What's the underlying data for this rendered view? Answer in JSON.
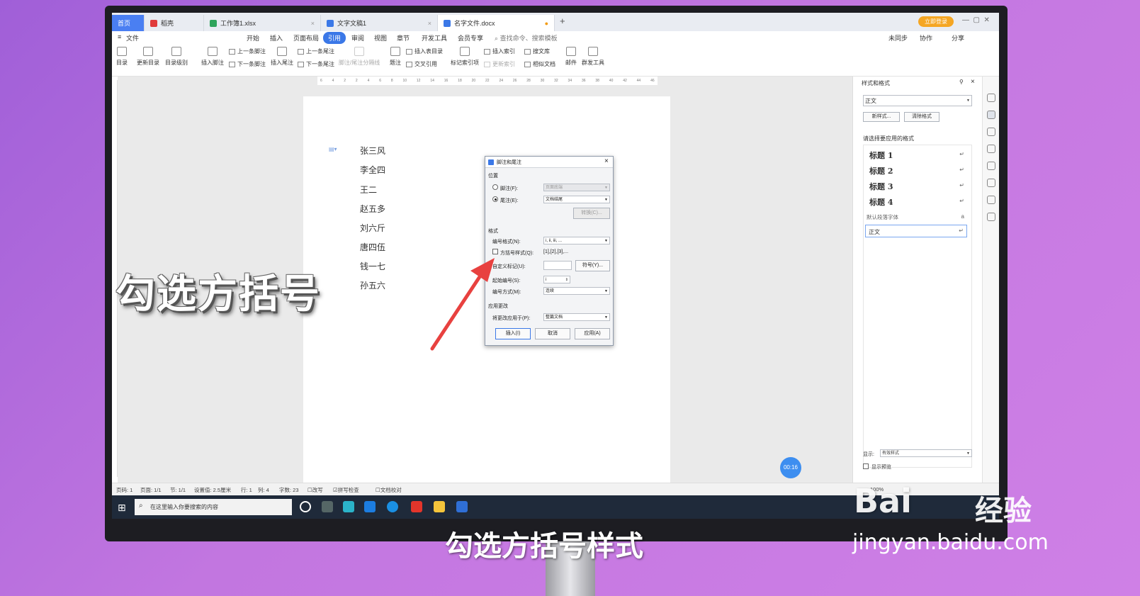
{
  "tabs": [
    {
      "label": "首页",
      "color": "#4a7ff2"
    },
    {
      "label": "稻壳",
      "color": "#e03b3b"
    },
    {
      "label": "工作簿1.xlsx",
      "color": "#2fa45c"
    },
    {
      "label": "文字文稿1",
      "color": "#3b78e7"
    },
    {
      "label": "名字文件.docx",
      "color": "#3b78e7"
    }
  ],
  "tab_add": "+",
  "login_button": "立即登录",
  "menu": [
    "文件",
    "开始",
    "插入",
    "页面布局",
    "引用",
    "审阅",
    "视图",
    "章节",
    "开发工具",
    "会员专享"
  ],
  "menu_active": "引用",
  "search_placeholder": "查找命令、搜索模板",
  "top_right": [
    "未同步",
    "协作",
    "分享"
  ],
  "ribbon": {
    "toc": "目录",
    "update_toc": "更新目录",
    "toc_level": "目录级别",
    "insert_footnote": "插入脚注",
    "prev_footnote": "上一条脚注",
    "next_footnote": "下一条脚注",
    "insert_endnote": "插入尾注",
    "prev_endnote": "上一条尾注",
    "next_endnote": "下一条尾注",
    "separator": "脚注/尾注分隔线",
    "caption": "题注",
    "insert_table_toc": "插入表目录",
    "cross_ref": "交叉引用",
    "mark_index": "标记索引项",
    "insert_index": "插入索引",
    "update_index": "更新索引",
    "search_lib": "搜文库",
    "similar": "相似文档",
    "mail": "邮件",
    "mass_tool": "群发工具"
  },
  "ruler_ticks": [
    "6",
    "4",
    "2",
    "2",
    "4",
    "6",
    "8",
    "10",
    "12",
    "14",
    "16",
    "18",
    "20",
    "22",
    "24",
    "26",
    "28",
    "30",
    "32",
    "34",
    "36",
    "38",
    "40",
    "42",
    "44",
    "46"
  ],
  "names": [
    "张三风",
    "李全四",
    "王二",
    "赵五多",
    "刘六斤",
    "唐四伍",
    "钱一七",
    "孙五六"
  ],
  "dialog": {
    "title": "脚注和尾注",
    "position_label": "位置",
    "footnote_label": "脚注(F):",
    "footnote_value": "页面底端",
    "endnote_label": "尾注(E):",
    "endnote_value": "文档结尾",
    "convert_button": "转换(C)...",
    "format_label": "格式",
    "number_format_label": "编号格式(N):",
    "number_format_value": "i, ii, iii, ...",
    "bracket_label": "方括号样式(Q):",
    "bracket_value": "[1],[2],[3],...",
    "custom_mark_label": "自定义标记(U):",
    "symbol_button": "符号(Y)...",
    "start_label": "起始编号(S):",
    "start_value": "i",
    "numbering_label": "编号方式(M):",
    "numbering_value": "连续",
    "apply_section": "应用更改",
    "apply_to_label": "将更改应用于(P):",
    "apply_to_value": "整篇文档",
    "insert_button": "插入(I)",
    "cancel_button": "取消",
    "apply_button": "应用(A)"
  },
  "pane": {
    "title": "样式和格式",
    "current_style": "正文",
    "new_style": "新样式...",
    "clear_format": "清除格式",
    "choose_label": "请选择要应用的格式",
    "styles": [
      "标题 1",
      "标题 2",
      "标题 3",
      "标题 4"
    ],
    "default_font": "默认段落字体",
    "body": "正文",
    "show_label": "显示:",
    "show_value": "有效样式",
    "preview": "显示预览"
  },
  "status": [
    "页码: 1",
    "页面: 1/1",
    "节: 1/1",
    "设置值: 2.5厘米",
    "行: 1",
    "列: 4",
    "字数: 23",
    "改写",
    "拼写检查",
    "文档校对"
  ],
  "zoom": "100%",
  "taskbar_search": "在这里输入你要搜索的内容",
  "timer": "00:16",
  "overlay_text": "勾选方括号",
  "subtitle": "勾选方括号样式",
  "watermark_logo": "Bai",
  "watermark_jingyan": "经验",
  "watermark_url": "jingyan.baidu.com"
}
